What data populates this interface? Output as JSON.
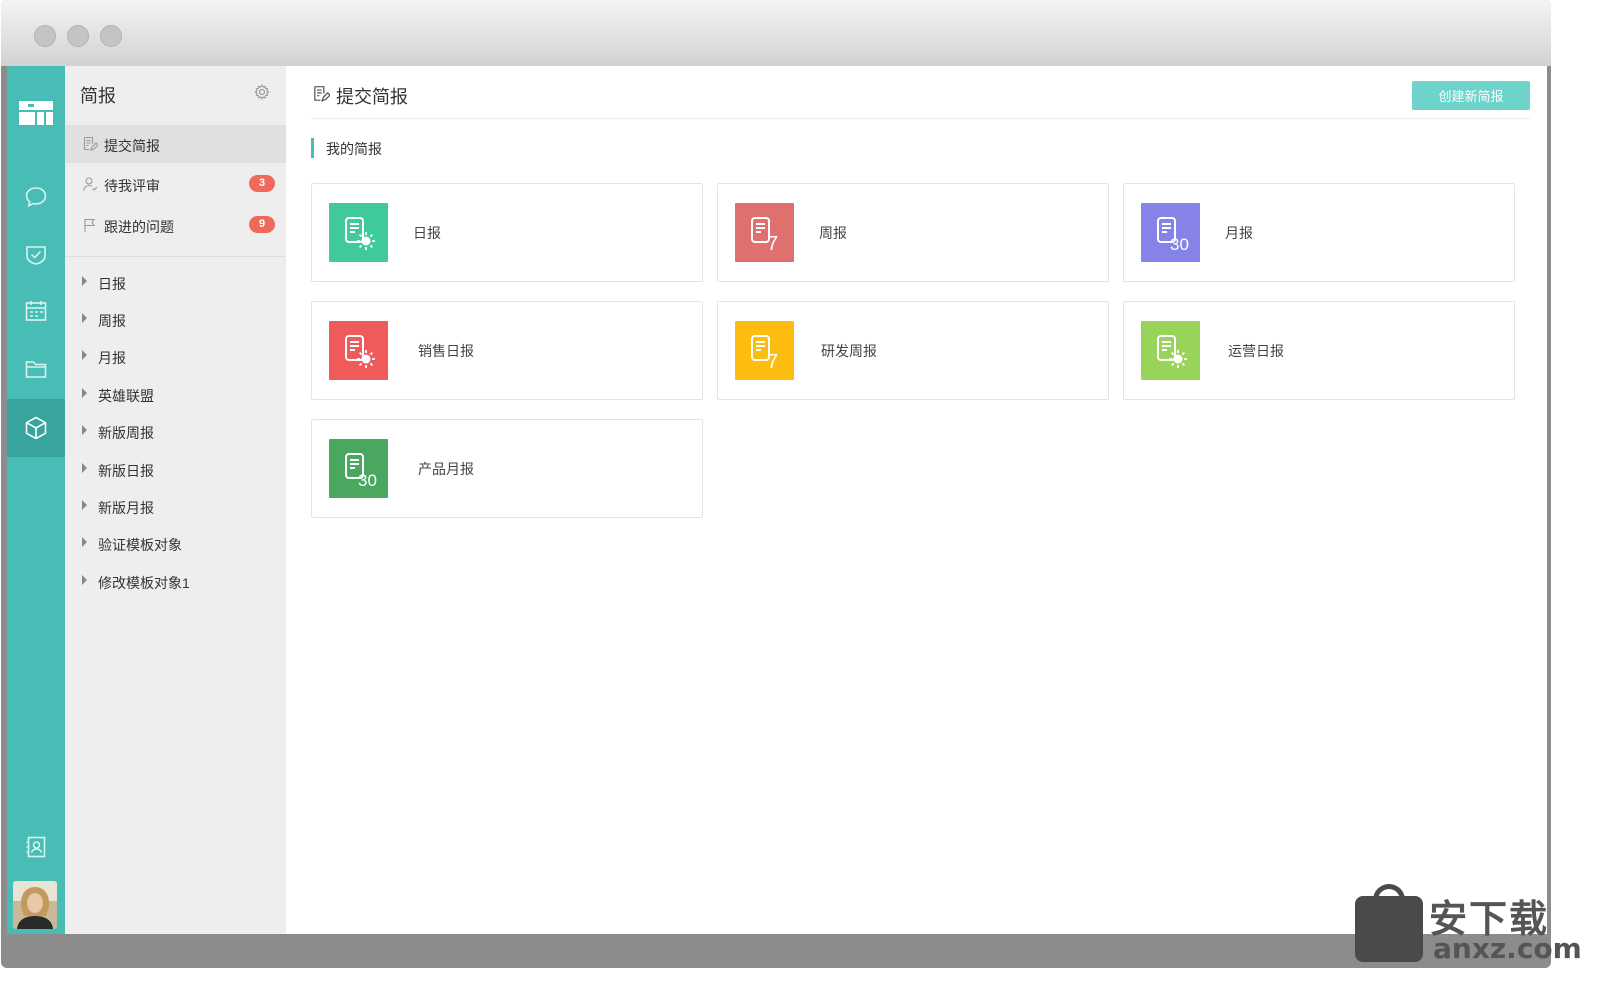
{
  "sidebar": {
    "title": "简报",
    "nav": [
      {
        "label": "提交简报"
      },
      {
        "label": "待我评审",
        "badge": "3"
      },
      {
        "label": "跟进的问题",
        "badge": "9"
      }
    ],
    "tree": [
      "日报",
      "周报",
      "月报",
      "英雄联盟",
      "新版周报",
      "新版日报",
      "新版月报",
      "验证模板对象",
      "修改模板对象1"
    ]
  },
  "main": {
    "title": "提交简报",
    "create_button": "创建新简报",
    "section_title": "我的简报",
    "cards": [
      {
        "label": "日报",
        "icon": "sun",
        "color": "#3fc99c"
      },
      {
        "label": "周报",
        "icon": "7",
        "color": "#e07070"
      },
      {
        "label": "月报",
        "icon": "30",
        "color": "#8583e8"
      },
      {
        "label": "销售日报",
        "icon": "sun",
        "color": "#ef5a5a"
      },
      {
        "label": "研发周报",
        "icon": "7",
        "color": "#fcbd10"
      },
      {
        "label": "运营日报",
        "icon": "sun",
        "color": "#98d35a"
      },
      {
        "label": "产品月报",
        "icon": "30",
        "color": "#4aa760"
      }
    ]
  },
  "colors": {
    "accent": "#47bdb6",
    "badge": "#f06a5b",
    "button": "#6dd3cb"
  },
  "watermark": {
    "line1": "安下载",
    "line2": "anxz.com"
  }
}
